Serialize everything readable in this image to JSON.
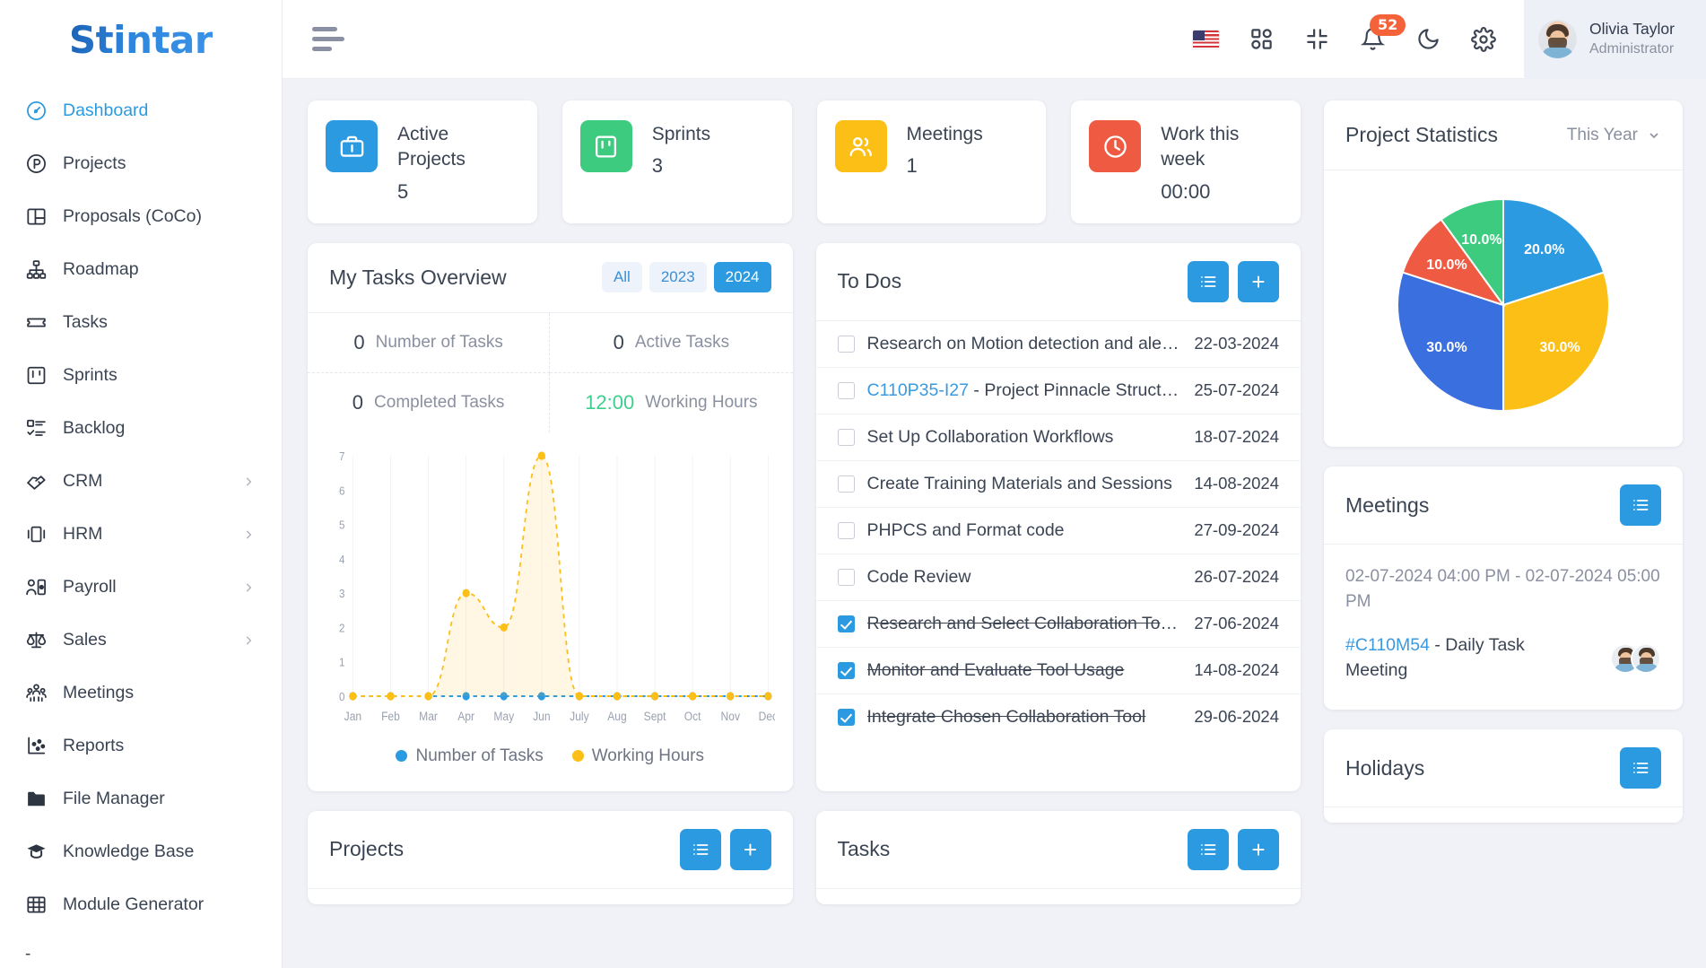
{
  "brand": {
    "name": "Stintar",
    "accent": "#2b9ae0"
  },
  "sidebar": {
    "items": [
      {
        "label": "Dashboard",
        "icon": "gauge-icon",
        "active": true,
        "expandable": false
      },
      {
        "label": "Projects",
        "icon": "circle-p-icon",
        "active": false,
        "expandable": false
      },
      {
        "label": "Proposals (CoCo)",
        "icon": "layout-panel-icon",
        "active": false,
        "expandable": false
      },
      {
        "label": "Roadmap",
        "icon": "hierarchy-icon",
        "active": false,
        "expandable": false
      },
      {
        "label": "Tasks",
        "icon": "ticket-icon",
        "active": false,
        "expandable": false
      },
      {
        "label": "Sprints",
        "icon": "board-icon",
        "active": false,
        "expandable": false
      },
      {
        "label": "Backlog",
        "icon": "checklist-icon",
        "active": false,
        "expandable": false
      },
      {
        "label": "CRM",
        "icon": "handshake-icon",
        "active": false,
        "expandable": true
      },
      {
        "label": "HRM",
        "icon": "id-card-icon",
        "active": false,
        "expandable": true
      },
      {
        "label": "Payroll",
        "icon": "user-money-icon",
        "active": false,
        "expandable": true
      },
      {
        "label": "Sales",
        "icon": "scales-icon",
        "active": false,
        "expandable": true
      },
      {
        "label": "Meetings",
        "icon": "people-group-icon",
        "active": false,
        "expandable": false
      },
      {
        "label": "Reports",
        "icon": "scatter-chart-icon",
        "active": false,
        "expandable": false
      },
      {
        "label": "File Manager",
        "icon": "folder-icon",
        "active": false,
        "expandable": false
      },
      {
        "label": "Knowledge Base",
        "icon": "graduation-cap-icon",
        "active": false,
        "expandable": false
      },
      {
        "label": "Module Generator",
        "icon": "grid-table-icon",
        "active": false,
        "expandable": false
      }
    ]
  },
  "topbar": {
    "menu_toggle": "menu-toggle",
    "language_flag": "us-flag-icon",
    "apps": "apps-grid-icon",
    "fullscreen": "collapse-screen-icon",
    "notifications_count": "52",
    "dark_mode": "moon-icon",
    "settings": "gear-icon",
    "user": {
      "name": "Olivia Taylor",
      "role": "Administrator"
    }
  },
  "stats": [
    {
      "title": "Active Projects",
      "value": "5",
      "icon": "briefcase-icon",
      "color": "#2b9ae0"
    },
    {
      "title": "Sprints",
      "value": "3",
      "icon": "board-icon",
      "color": "#3ccb7f"
    },
    {
      "title": "Meetings",
      "value": "1",
      "icon": "users-icon",
      "color": "#fcbf16"
    },
    {
      "title": "Work this week",
      "value": "00:00",
      "icon": "clock-icon",
      "color": "#ef5b42"
    }
  ],
  "tasks_overview": {
    "title": "My Tasks Overview",
    "filters": [
      {
        "label": "All",
        "active": false
      },
      {
        "label": "2023",
        "active": false
      },
      {
        "label": "2024",
        "active": true
      }
    ],
    "cells": [
      {
        "value": "0",
        "label": "Number of Tasks",
        "green": false
      },
      {
        "value": "0",
        "label": "Active Tasks",
        "green": false
      },
      {
        "value": "0",
        "label": "Completed Tasks",
        "green": false
      },
      {
        "value": "12:00",
        "label": "Working Hours",
        "green": true
      }
    ]
  },
  "todos": {
    "title": "To Dos",
    "list_button": "list-icon",
    "add_button": "+",
    "items": [
      {
        "text": "Research on Motion detection and alerts.",
        "code": "",
        "date": "22-03-2024",
        "checked": false
      },
      {
        "text": "Project Pinnacle Structure",
        "code": "C110P35-I27",
        "date": "25-07-2024",
        "checked": false
      },
      {
        "text": "Set Up Collaboration Workflows",
        "code": "",
        "date": "18-07-2024",
        "checked": false
      },
      {
        "text": "Create Training Materials and Sessions",
        "code": "",
        "date": "14-08-2024",
        "checked": false
      },
      {
        "text": "PHPCS and Format code",
        "code": "",
        "date": "27-09-2024",
        "checked": false
      },
      {
        "text": "Code Review",
        "code": "",
        "date": "26-07-2024",
        "checked": false
      },
      {
        "text": "Research and Select Collaboration Tools",
        "code": "",
        "date": "27-06-2024",
        "checked": true
      },
      {
        "text": "Monitor and Evaluate Tool Usage",
        "code": "",
        "date": "14-08-2024",
        "checked": true
      },
      {
        "text": "Integrate Chosen Collaboration Tool",
        "code": "",
        "date": "29-06-2024",
        "checked": true
      }
    ]
  },
  "project_statistics": {
    "title": "Project Statistics",
    "range": "This Year"
  },
  "meetings_panel": {
    "title": "Meetings",
    "list_button": "list-icon",
    "time": "02-07-2024 04:00 PM - 02-07-2024 05:00 PM",
    "code": "#C110M54",
    "name": " - Daily Task Meeting"
  },
  "bottom_panels": {
    "projects": {
      "title": "Projects",
      "list_button": "list-icon",
      "add_button": "+"
    },
    "tasks": {
      "title": "Tasks",
      "list_button": "list-icon",
      "add_button": "+"
    },
    "holidays": {
      "title": "Holidays",
      "list_button": "list-icon"
    }
  },
  "chart_data": [
    {
      "type": "area",
      "title": "My Tasks Overview",
      "categories": [
        "Jan",
        "Feb",
        "Mar",
        "Apr",
        "May",
        "Jun",
        "July",
        "Aug",
        "Sept",
        "Oct",
        "Nov",
        "Dec"
      ],
      "series": [
        {
          "name": "Number of Tasks",
          "color": "#2b9ae0",
          "values": [
            0,
            0,
            0,
            0,
            0,
            0,
            0,
            0,
            0,
            0,
            0,
            0
          ]
        },
        {
          "name": "Working Hours",
          "color": "#fcbf16",
          "values": [
            0,
            0,
            0,
            3,
            2,
            7,
            0,
            0,
            0,
            0,
            0,
            0
          ]
        }
      ],
      "ylim": [
        0,
        7
      ],
      "yticks": [
        0,
        1,
        2,
        3,
        4,
        5,
        6,
        7
      ],
      "xlabel": "",
      "ylabel": "",
      "grid": true,
      "legend_position": "bottom"
    },
    {
      "type": "pie",
      "title": "Project Statistics",
      "labels": [
        "20.0%",
        "30.0%",
        "30.0%",
        "10.0%",
        "10.0%"
      ],
      "values": [
        20,
        30,
        30,
        10,
        10
      ],
      "colors": [
        "#2b9ae0",
        "#fcbf16",
        "#3a6fe0",
        "#ef5b42",
        "#3ccb7f"
      ],
      "legend_position": "none"
    }
  ]
}
